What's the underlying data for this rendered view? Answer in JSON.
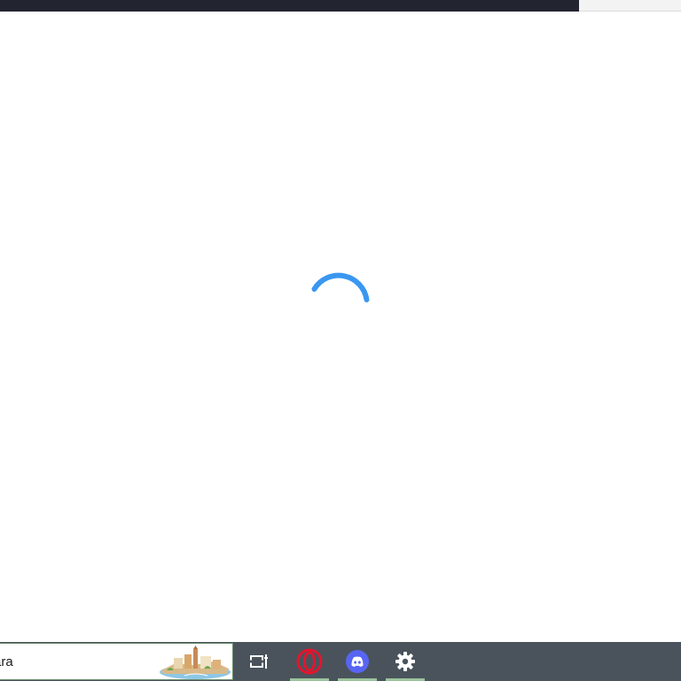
{
  "taskbar": {
    "search": {
      "text": "ara",
      "icon": "search-highlight-landscape"
    },
    "apps": [
      {
        "name": "task-view",
        "icon": "task-view-icon",
        "running": false
      },
      {
        "name": "opera",
        "icon": "opera-icon",
        "running": true
      },
      {
        "name": "discord",
        "icon": "discord-icon",
        "running": true
      },
      {
        "name": "settings",
        "icon": "gear-icon",
        "running": true
      }
    ]
  },
  "content": {
    "state": "loading",
    "spinner_color": "#3a97f0"
  },
  "colors": {
    "top_bar": "#222430",
    "taskbar": "#4a535c",
    "indicator": "#9bc49b",
    "opera": "#e0162e",
    "discord": "#5865f2"
  }
}
